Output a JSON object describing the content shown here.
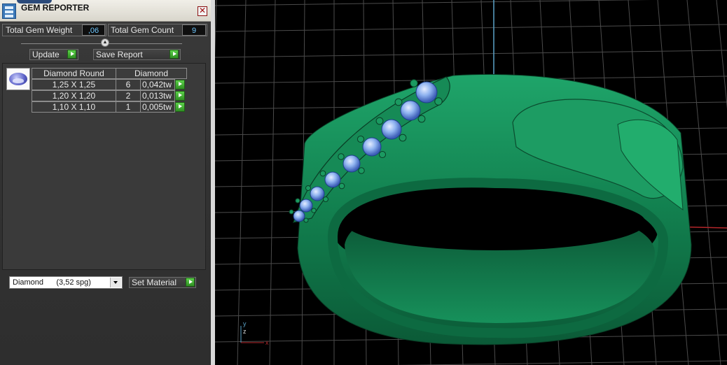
{
  "window": {
    "title": "GEM REPORTER",
    "close_label": "✕"
  },
  "summary": {
    "total_weight_label": "Total Gem Weight",
    "total_weight_value": ",06",
    "total_count_label": "Total Gem Count",
    "total_count_value": "9"
  },
  "actions": {
    "update_label": "Update",
    "save_report_label": "Save Report"
  },
  "gem_table": {
    "headers": {
      "shape": "Diamond Round",
      "material": "Diamond"
    },
    "rows": [
      {
        "size": "1,25 X 1,25",
        "count": "6",
        "weight": "0,042tw"
      },
      {
        "size": "1,20 X 1,20",
        "count": "2",
        "weight": "0,013tw"
      },
      {
        "size": "1,10 X 1,10",
        "count": "1",
        "weight": "0,005tw"
      }
    ]
  },
  "material": {
    "selected": "Diamond      (3,52 spg)",
    "set_label": "Set Material"
  },
  "viewport": {
    "axis_labels": {
      "x": "x",
      "y": "y",
      "z": "z"
    },
    "colors": {
      "metal": "#1a8f5c",
      "gem": "#8fb3f0",
      "grid": "#4b4b4b",
      "x_axis": "#b3262a",
      "z_axis": "#5aa2c7"
    }
  },
  "icons": {
    "app": "gem-reporter-app-icon",
    "close": "close-icon",
    "collapse": "collapse-up-icon",
    "go": "green-play-arrow-icon",
    "dropdown": "chevron-down-icon",
    "gem": "round-diamond-icon"
  }
}
